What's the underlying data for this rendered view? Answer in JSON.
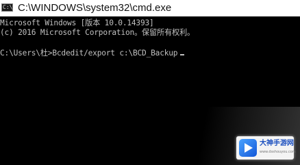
{
  "window": {
    "title": "C:\\WINDOWS\\system32\\cmd.exe",
    "icon": "cmd-icon"
  },
  "console": {
    "lines": [
      "Microsoft Windows [版本 10.0.14393]",
      "(c) 2016 Microsoft Corporation。保留所有权利。",
      "",
      "C:\\Users\\杜>Bcdedit/export c:\\BCD_Backup"
    ]
  },
  "watermark": {
    "title": "大神手游网",
    "subtitle": "www.dsshouyou.com"
  }
}
